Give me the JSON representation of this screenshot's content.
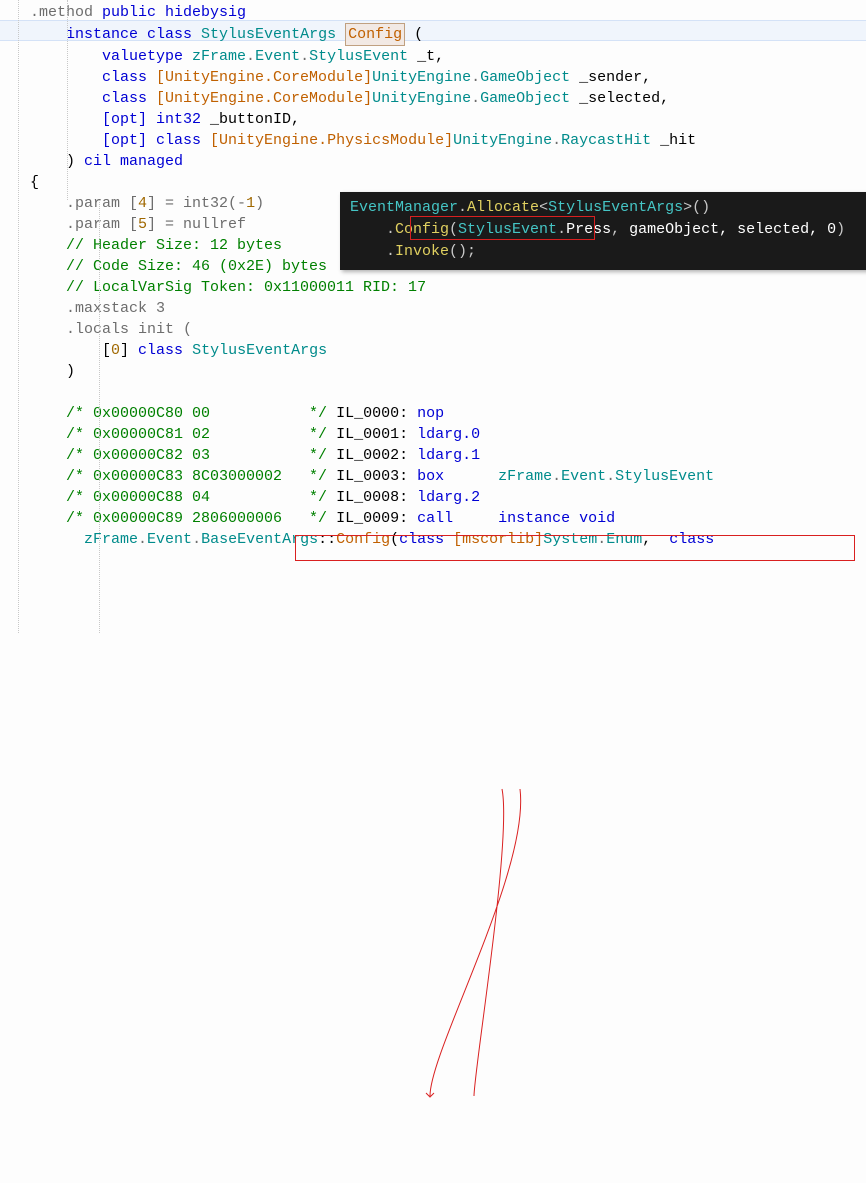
{
  "il": {
    "l1a": ".method",
    "l1b": " public hidebysig",
    "l2a": "    instance ",
    "l2b": "class",
    "l2c": " StylusEventArgs",
    "l2d": "Config",
    "l2e": " (\n",
    "l3a": "        valuetype ",
    "l3b": "zFrame",
    "l3c": ".",
    "l3d": "Event",
    "l3e": ".",
    "l3f": "StylusEvent",
    "l3g": " _t,",
    "l4a": "        class ",
    "l4b": "[UnityEngine.CoreModule]",
    "l4c": "UnityEngine",
    "l4d": ".",
    "l4e": "GameObject",
    "l4f": " _sender,",
    "l5f": " _selected,",
    "l6a": "        [opt] ",
    "l6b": "int32",
    "l6c": " _buttonID,",
    "l7a": "        [opt] ",
    "l7b": "class ",
    "l7c": "[UnityEngine.PhysicsModule]",
    "l7d": "UnityEngine",
    "l7e": ".",
    "l7f": "RaycastHit",
    "l7g": " _hit",
    "l8": "    ) ",
    "l8b": "cil managed",
    "l9": "{",
    "l10a": "    .param [",
    "l10b": "4",
    "l10c": "] = int32(-",
    "l10d": "1",
    "l10e": ")",
    "l11a": "    .param [",
    "l11b": "5",
    "l11c": "] = nullref",
    "l12": "    // Header Size: 12 bytes",
    "l13": "    // Code Size: 46 (0x2E) bytes",
    "l14": "    // LocalVarSig Token: 0x11000011 RID: 17",
    "l15": "    .maxstack 3",
    "l16": "    .locals init (",
    "l17a": "        [",
    "l17b": "0",
    "l17c": "] ",
    "l17d": "class",
    "l17e": " StylusEventArgs",
    "l18": "    )",
    "l19": "",
    "il0000a": "    /* 0x00000C80 00           */",
    "il0000b": " IL_0000: ",
    "il0000c": "nop",
    "il0001a": "    /* 0x00000C81 02           */",
    "il0001b": " IL_0001: ",
    "il0001c": "ldarg.0",
    "il0002a": "    /* 0x00000C82 03           */",
    "il0002b": " IL_0002: ",
    "il0002c": "ldarg.1",
    "il0003a": "    /* 0x00000C83 8C03000002   */",
    "il0003b": " IL_0003: ",
    "il0003c": "box",
    "il0003d": "      ",
    "il0003e": "zFrame",
    "il0003f": ".",
    "il0003g": "Event",
    "il0003h": ".",
    "il0003i": "StylusEvent",
    "il0008a": "    /* 0x00000C88 04           */",
    "il0008b": " IL_0008: ",
    "il0008c": "ldarg.2",
    "il0009a": "    /* 0x00000C89 2806000006   */",
    "il0009b": " IL_0009: ",
    "il0009c": "call",
    "il0009d": "     ",
    "il0009e": "instance",
    "il0009f": " ",
    "il0009g": "void",
    "l_btm1a": "      zFrame",
    "l_btm1b": ".",
    "l_btm1c": "Event",
    "l_btm1d": ".",
    "l_btm1e": "BaseEventArgs",
    "l_btm1f": "::",
    "l_btm1g": "Config",
    "l_btm1h": "(",
    "l_btm1i": "class",
    "l_btm1j": " [mscorlib]",
    "l_btm1k": "System",
    "l_btm1l": ".",
    "l_btm1m": "Enum",
    "l_btm1n": ",  ",
    "l_btm1o": "class"
  },
  "tooltip": {
    "t1a": "EventManager",
    "t1b": ".",
    "t1c": "Allocate",
    "t1d": "<",
    "t1e": "StylusEventArgs",
    "t1f": ">()",
    "t2a": "    .",
    "t2b": "Config",
    "t2c": "(",
    "t2d": "StylusEvent",
    "t2e": ".",
    "t2f": "Press",
    "t2g": ",",
    "t2h": " gameObject, selected, 0",
    "t2i": ")",
    "t3a": "    .",
    "t3b": "Invoke",
    "t3c": "();"
  }
}
